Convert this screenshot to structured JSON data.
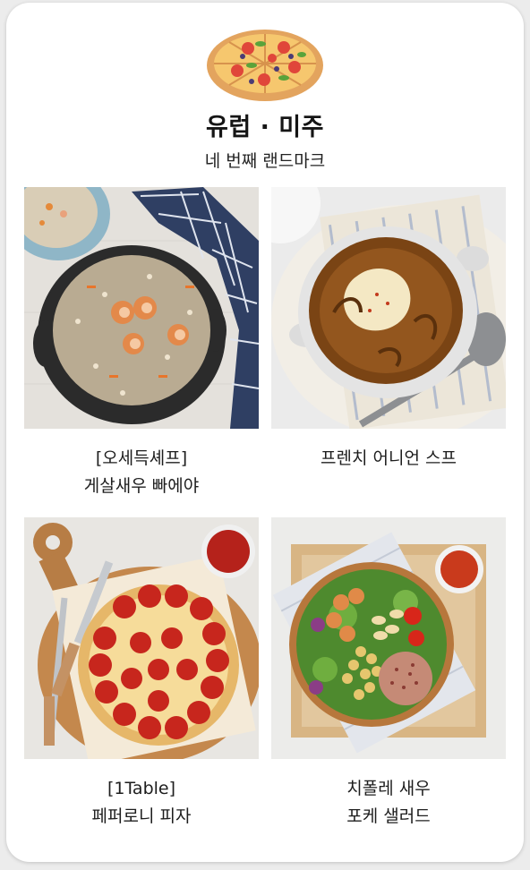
{
  "section": {
    "icon": "pizza-icon",
    "title": "유럽 · 미주",
    "subtitle": "네 번째 랜드마크"
  },
  "menu_items": [
    {
      "line1": "[오세득셰프]",
      "line2": "게살새우 빠에야",
      "icon": "paella-image"
    },
    {
      "line1": "프렌치 어니언 스프",
      "line2": "",
      "icon": "onion-soup-image"
    },
    {
      "line1": "[1Table]",
      "line2": "페퍼로니 피자",
      "icon": "pepperoni-pizza-image"
    },
    {
      "line1": "치폴레 새우",
      "line2": "포케 샐러드",
      "icon": "poke-salad-image"
    }
  ],
  "colors": {
    "card_bg": "#ffffff",
    "page_bg": "#ececec",
    "title": "#151515",
    "text": "#1d1d1d"
  }
}
